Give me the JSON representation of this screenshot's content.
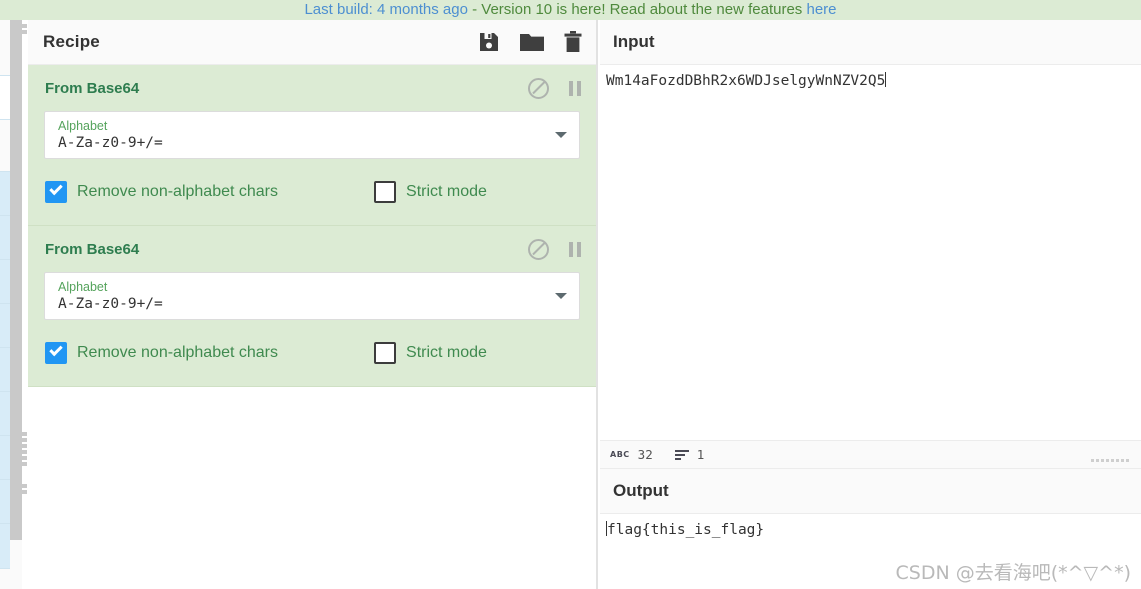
{
  "banner": {
    "build_text": "Last build: 4 months ago",
    "separator": " - ",
    "version_text": "Version 10 is here! Read about the new features ",
    "link_text": "here"
  },
  "recipe": {
    "title": "Recipe",
    "icons": [
      {
        "name": "save-icon",
        "label": "Save recipe"
      },
      {
        "name": "folder-icon",
        "label": "Load recipe"
      },
      {
        "name": "trash-icon",
        "label": "Clear recipe"
      }
    ],
    "operations": [
      {
        "name": "From Base64",
        "disable_label": "Disable operation",
        "breakpoint_label": "Set breakpoint",
        "arg_label": "Alphabet",
        "arg_value": "A-Za-z0-9+/=",
        "checks": [
          {
            "label": "Remove non-alphabet chars",
            "checked": true
          },
          {
            "label": "Strict mode",
            "checked": false
          }
        ]
      },
      {
        "name": "From Base64",
        "disable_label": "Disable operation",
        "breakpoint_label": "Set breakpoint",
        "arg_label": "Alphabet",
        "arg_value": "A-Za-z0-9+/=",
        "checks": [
          {
            "label": "Remove non-alphabet chars",
            "checked": true
          },
          {
            "label": "Strict mode",
            "checked": false
          }
        ]
      }
    ]
  },
  "input": {
    "title": "Input",
    "value": "Wm14aFozdDBhR2x6WDJselgyWnNZV2Q5",
    "status": {
      "length_icon": "abc-icon",
      "length": "32",
      "lines_icon": "lines-icon",
      "lines": "1"
    }
  },
  "output": {
    "title": "Output",
    "value": "flag{this_is_flag}"
  },
  "watermark": {
    "text": "CSDN @去看海吧(*^▽^*)"
  },
  "colors": {
    "banner_bg": "#dcebd4",
    "operation_bg": "#dcebd4",
    "operation_title": "#2e7d4f",
    "checkbox_on": "#2196f3",
    "link": "#4d8fd1"
  }
}
